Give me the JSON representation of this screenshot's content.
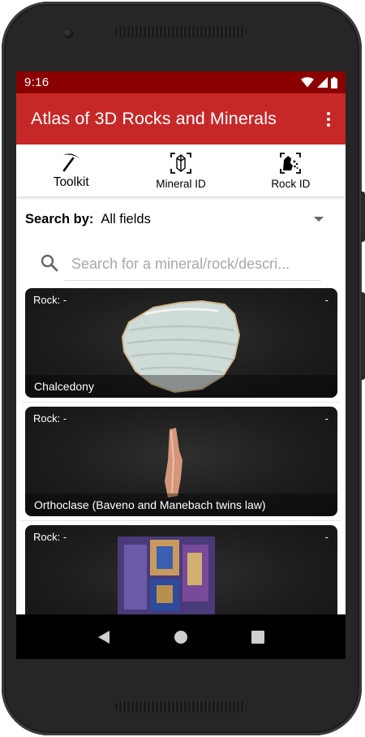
{
  "status_bar": {
    "time": "9:16",
    "icons": [
      "wifi-icon",
      "cell-signal-icon",
      "battery-icon"
    ],
    "color": "#8a0000"
  },
  "app_bar": {
    "title": "Atlas of 3D Rocks and Minerals",
    "color": "#c62828",
    "overflow_icon": "more-vert-icon"
  },
  "tabs": [
    {
      "label": "Toolkit",
      "icon": "pickaxe-icon"
    },
    {
      "label": "Mineral ID",
      "icon": "crystal-scan-icon"
    },
    {
      "label": "Rock ID",
      "icon": "rock-scan-icon"
    }
  ],
  "search_by": {
    "label": "Search by:",
    "value": "All fields"
  },
  "search": {
    "placeholder": "Search for a mineral/rock/descri..."
  },
  "cards": [
    {
      "rock_label": "Rock: -",
      "corner": "-",
      "name": "Chalcedony"
    },
    {
      "rock_label": "Rock: -",
      "corner": "-",
      "name": "Orthoclase (Baveno and Manebach twins law)"
    },
    {
      "rock_label": "Rock: -",
      "corner": "-",
      "name": ""
    }
  ],
  "nav_bar": {
    "icons": [
      "back-icon",
      "home-icon",
      "recents-icon"
    ]
  }
}
